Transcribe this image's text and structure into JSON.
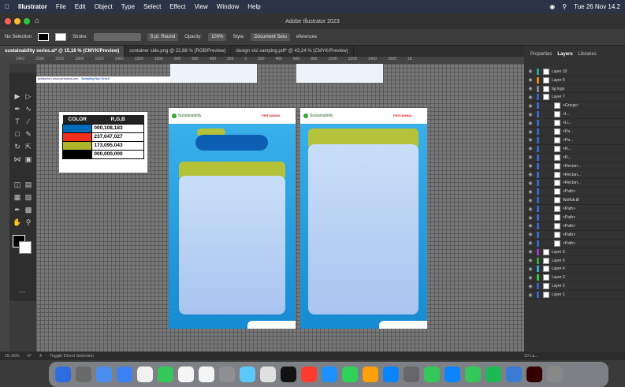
{
  "menubar": {
    "app": "Illustrator",
    "items": [
      "File",
      "Edit",
      "Object",
      "Type",
      "Select",
      "Effect",
      "View",
      "Window",
      "Help"
    ],
    "clock": "Tue 26 Nov 14.2"
  },
  "window": {
    "title": "Adobe Illustrator 2023"
  },
  "control": {
    "selection": "No Selection",
    "stroke": "Stroke:",
    "brush": "5 pt. Round",
    "opacity_label": "Opacity:",
    "opacity": "100%",
    "style": "Style:",
    "doc_setup": "Document Setu",
    "prefs": "eferences"
  },
  "tabs": [
    "sustainability series.ai* @ 15,16 % (CMYK/Preview)",
    "container side.png @ 22,88 % (RGB/Preview)",
    "design sisi samping.pdf* @ 43,24 % (CMYK/Preview)"
  ],
  "ruler": [
    "2400",
    "2200",
    "2000",
    "1800",
    "1600",
    "1400",
    "1200",
    "1000",
    "800",
    "600",
    "400",
    "200",
    "0",
    "200",
    "400",
    "600",
    "800",
    "1000",
    "1200",
    "1400",
    "1600",
    "18"
  ],
  "colortable": {
    "header": [
      "COLOR",
      "R,G,B"
    ],
    "rows": [
      {
        "color": "#006cb7",
        "value": "000,108,183"
      },
      {
        "color": "#ed2f1b",
        "value": "237,047,027"
      },
      {
        "color": "#adb42b",
        "value": "173,095,043"
      },
      {
        "color": "#000000",
        "value": "000,000,000"
      }
    ]
  },
  "artboard": {
    "logo_left": "Sustainability",
    "logo_right": "PERTAMINA",
    "strip_text": "pertamina | www.pertamina.com",
    "strip_label": "Sampling Non Grosir"
  },
  "right_panel": {
    "tabs": [
      "Properties",
      "Layers",
      "Libraries"
    ],
    "layers": [
      "Layer 10",
      "Layer 9",
      "bg logo",
      "Layer 7",
      "<Group>",
      "<I...",
      "<Li...",
      "<Pa...",
      "<Pa...",
      "<R...",
      "<R...",
      "<Rectan...",
      "<Rectan...",
      "<Rectan...",
      "<Path>",
      "Wolfuk.tif",
      "<Path>",
      "<Path>",
      "<Path>",
      "<Path>",
      "<Path>",
      "Layer 5",
      "Layer 6",
      "Layer 4",
      "Layer 3",
      "Layer 2",
      "Layer 1"
    ],
    "footer": "10 La..."
  },
  "status": {
    "zoom": "15,16%",
    "angle": "0°",
    "page": "4",
    "tool": "Toggle Direct Selection"
  },
  "colors": {
    "accent_blue": "#2aa7e6",
    "olive": "#b4c23a",
    "card": "#c4d9f6"
  }
}
